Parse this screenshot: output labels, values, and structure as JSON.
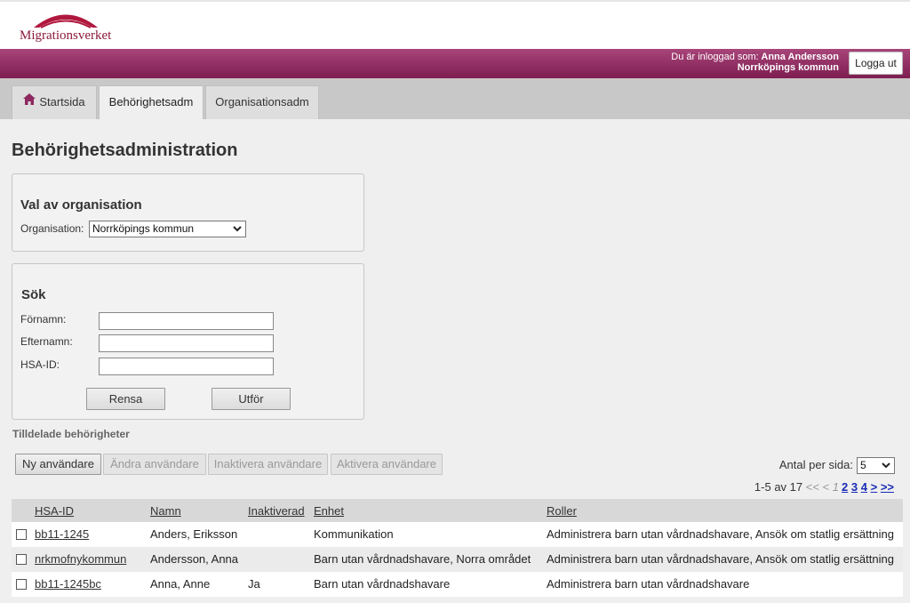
{
  "header": {
    "logo_text": "Migrationsverket",
    "user_label": "Du är inloggad som:",
    "user_name": "Anna Andersson",
    "user_org": "Norrköpings kommun",
    "logout_label": "Logga ut"
  },
  "tabs": [
    {
      "label": "Startsida",
      "icon": "home-icon",
      "active": false
    },
    {
      "label": "Behörighetsadm",
      "active": true
    },
    {
      "label": "Organisationsadm",
      "active": false
    }
  ],
  "page_title": "Behörighetsadministration",
  "org_panel": {
    "title": "Val av organisation",
    "org_label": "Organisation:",
    "org_value": "Norrköpings kommun"
  },
  "search_panel": {
    "title": "Sök",
    "fields": [
      {
        "label": "Förnamn:",
        "value": ""
      },
      {
        "label": "Efternamn:",
        "value": ""
      },
      {
        "label": "HSA-ID:",
        "value": ""
      }
    ],
    "clear_label": "Rensa",
    "submit_label": "Utför"
  },
  "assigned": {
    "title": "Tilldelade behörigheter",
    "actions": [
      {
        "label": "Ny användare",
        "enabled": true
      },
      {
        "label": "Ändra användare",
        "enabled": false
      },
      {
        "label": "Inaktivera användare",
        "enabled": false
      },
      {
        "label": "Aktivera användare",
        "enabled": false
      }
    ],
    "per_page_label": "Antal per sida:",
    "per_page_value": "5",
    "pager": {
      "range_text": "1-5 av 17",
      "first": "<<",
      "prev": "<",
      "current": "1",
      "pages": [
        "2",
        "3",
        "4"
      ],
      "next": ">",
      "last": ">>"
    },
    "columns": [
      "HSA-ID",
      "Namn",
      "Inaktiverad",
      "Enhet",
      "Roller"
    ],
    "rows": [
      {
        "hsa_id": "bb11-1245",
        "name": "Anders, Eriksson",
        "inactive": "",
        "unit": "Kommunikation",
        "roles": "Administrera barn utan vårdnadshavare, Ansök om statlig ersättning"
      },
      {
        "hsa_id": "nrkmofnykommun",
        "name": "Andersson, Anna",
        "inactive": "",
        "unit": "Barn utan vårdnadshavare, Norra området",
        "roles": "Administrera barn utan vårdnadshavare, Ansök om statlig ersättning"
      },
      {
        "hsa_id": "bb11-1245bc",
        "name": "Anna, Anne",
        "inactive": "Ja",
        "unit": "Barn utan vårdnadshavare",
        "roles": "Administrera barn utan vårdnadshavare"
      }
    ]
  },
  "colors": {
    "brand": "#8b1a3b",
    "userbar": "#8e2a60",
    "link": "#1a2bb5"
  }
}
